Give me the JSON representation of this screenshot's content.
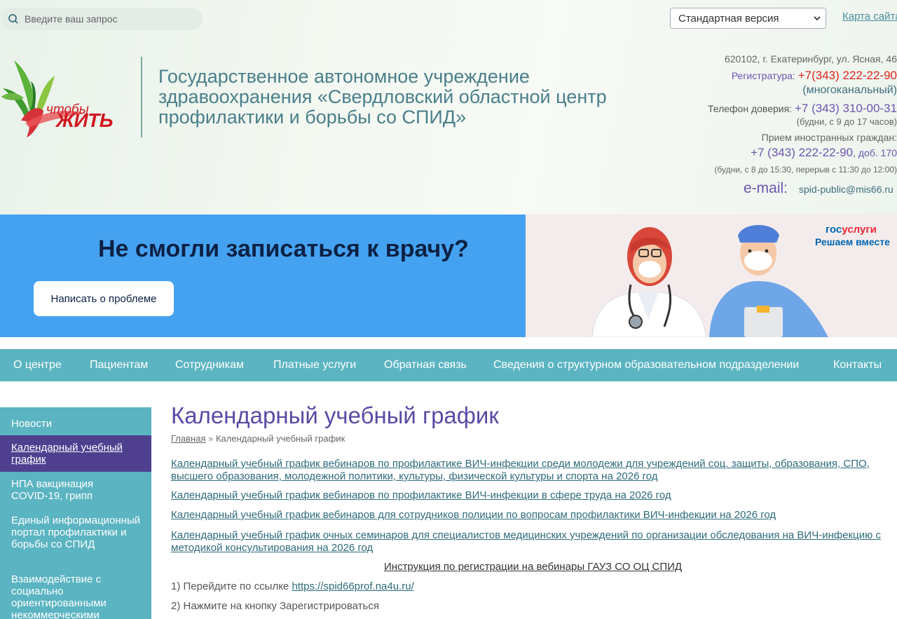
{
  "header": {
    "search_placeholder": "Введите ваш запрос",
    "version_select": "Стандартная версия",
    "sitemap": "Карта сайта",
    "logo_small": "чтобы",
    "logo_big": "ЖИТЬ",
    "org_line1": "Государственное автономное учреждение",
    "org_line2": "здравоохранения «Свердловский областной центр",
    "org_line3": "профилактики и борьбы со СПИД»"
  },
  "contacts": {
    "address": "620102, г. Екатеринбург, ул. Ясная, 46",
    "reg_label": "Регистратура:",
    "reg_phone": "+7(343) 222-22-90",
    "reg_note": "(многоканальный)",
    "trust_label": "Телефон доверия:",
    "trust_phone": "+7 (343) 310-00-31",
    "trust_hours": "(будни, с 9 до 17 часов)",
    "foreign_label": "Прием иностранных граждан:",
    "foreign_phone": "+7 (343) 222-22-90",
    "foreign_ext": ", доб. 170",
    "foreign_hours": "(будни, с 8 до 15:30, перерыв с 11:30 до 12:00)",
    "email_label": "e-mail:",
    "email": "spid-public@mis66.ru"
  },
  "banner": {
    "title": "Не смогли записаться к врачу?",
    "button": "Написать о проблеме",
    "gos_part1": "гос",
    "gos_part2": "услуги",
    "gos_sub": "Решаем вместе"
  },
  "nav": [
    "О центре",
    "Пациентам",
    "Сотрудникам",
    "Платные услуги",
    "Обратная связь",
    "Сведения о структурном образовательном подразделении",
    "Контакты"
  ],
  "sidebar": [
    "Новости",
    "Календарный учебный график",
    "НПА вакцинация COVID-19, грипп",
    "Единый информационный портал профилактики и борьбы со СПИД",
    "Взаимодействие с социально ориентированными некоммерческими"
  ],
  "main": {
    "title": "Календарный учебный график",
    "crumb_home": "Главная",
    "crumb_sep": "»",
    "crumb_current": "Календарный учебный график",
    "links": [
      "Календарный учебный график вебинаров по профилактике ВИЧ-инфекции среди молодежи для учреждений соц. защиты, образования, СПО, высшего образования, молодежной политики, культуры, физической культуры и спорта на 2026 год",
      "Календарный учебный график вебинаров по профилактике ВИЧ-инфекции в сфере труда на 2026 год",
      "Календарный учебный график вебинаров для сотрудников полиции по вопросам профилактики ВИЧ-инфекции на 2026 год",
      "Календарный учебный график очных семинаров для специалистов медицинских учреждений по организации обследования на ВИЧ-инфекцию с методикой консультирования на 2026 год"
    ],
    "instruction": "Инструкция по регистрации на вебинары ГАУЗ СО ОЦ СПИД",
    "step1_text": "1) Перейдите по ссылке",
    "step1_link": "https://spid66prof.na4u.ru/",
    "step2_text": "2) Нажмите на кнопку Зарегистрироваться"
  },
  "colors": {
    "accent_teal": "#5bb4c1",
    "accent_purple": "#5b4aa5",
    "banner_blue": "#45a2f1",
    "phone_red": "#e0261c"
  }
}
